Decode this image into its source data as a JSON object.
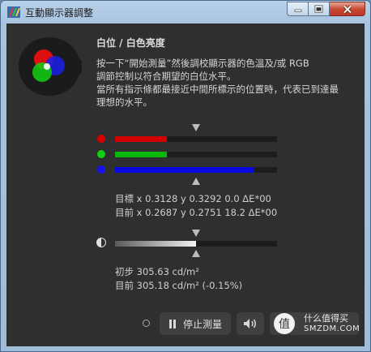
{
  "window": {
    "title": "互動顯示器調整"
  },
  "section": {
    "heading": "白位 / 白色亮度",
    "desc_lines": [
      "按一下“開始測量”然後調校顯示器的色溫及/或 RGB",
      "調節控制以符合期望的白位水平。",
      "當所有指示條都最接近中間所標示的位置時，代表已到達最",
      "理想的水平。"
    ]
  },
  "rgb": {
    "target_marker": 0.5,
    "bars": [
      {
        "name": "red",
        "color": "#d40000",
        "dot": "#d80000",
        "level": 0.32
      },
      {
        "name": "green",
        "color": "#08b808",
        "dot": "#12d012",
        "level": 0.32
      },
      {
        "name": "blue",
        "color": "#0a0ae0",
        "dot": "#1212f0",
        "level": 0.86
      }
    ],
    "target_line": "目標 x 0.3128 y 0.3292 0.0 ΔE*00",
    "current_line": "目前 x 0.2687 y 0.2751 18.2 ΔE*00"
  },
  "luminance": {
    "level": 0.5,
    "initial_line": "初步 305.63 cd/m²",
    "current_line": "目前 305.18 cd/m² (-0.15%)"
  },
  "controls": {
    "stop_label": "停止測量"
  },
  "overlay": {
    "watermark_text": "什么值得买",
    "watermark_domain": "SMZDM.COM"
  }
}
